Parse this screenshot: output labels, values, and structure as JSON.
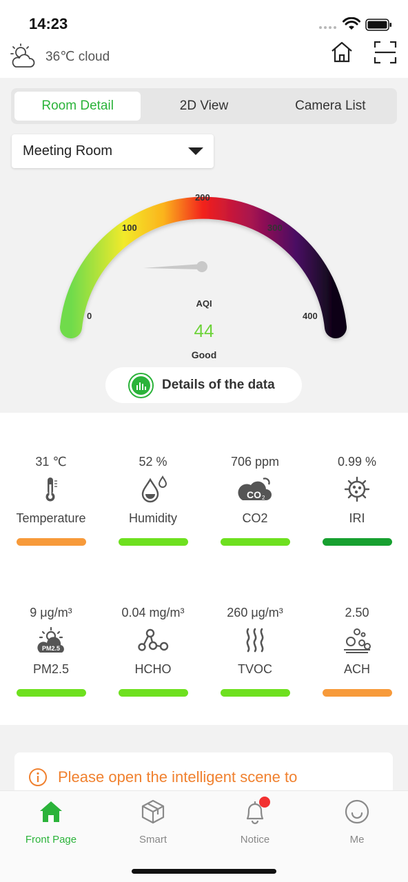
{
  "status_bar": {
    "time": "14:23"
  },
  "weather": {
    "text": "36℃ cloud",
    "icon": "partly-cloudy-icon"
  },
  "top_tabs": [
    {
      "label": "Room Detail",
      "active": true
    },
    {
      "label": "2D View",
      "active": false
    },
    {
      "label": "Camera List",
      "active": false
    }
  ],
  "room_select": {
    "value": "Meeting Room"
  },
  "gauge": {
    "min": 0,
    "max": 400,
    "ticks": [
      "0",
      "100",
      "200",
      "300",
      "400"
    ],
    "label": "AQI",
    "value": "44",
    "status": "Good",
    "value_color": "#6ed33a"
  },
  "details_button": {
    "label": "Details of the data"
  },
  "metrics": [
    {
      "value": "31 ℃",
      "label": "Temperature",
      "icon": "thermometer-icon",
      "bar_color": "#f79a3a"
    },
    {
      "value": "52 %",
      "label": "Humidity",
      "icon": "droplet-icon",
      "bar_color": "#6ee01f"
    },
    {
      "value": "706 ppm",
      "label": "CO2",
      "icon": "co2-cloud-icon",
      "bar_color": "#6ee01f"
    },
    {
      "value": "0.99 %",
      "label": "IRI",
      "icon": "virus-icon",
      "bar_color": "#17a030"
    },
    {
      "value": "9 μg/m³",
      "label": "PM2.5",
      "icon": "pm25-icon",
      "bar_color": "#6ee01f"
    },
    {
      "value": "0.04 mg/m³",
      "label": "HCHO",
      "icon": "molecule-icon",
      "bar_color": "#6ee01f"
    },
    {
      "value": "260 μg/m³",
      "label": "TVOC",
      "icon": "vapor-waves-icon",
      "bar_color": "#6ee01f"
    },
    {
      "value": "2.50",
      "label": "ACH",
      "icon": "air-change-icon",
      "bar_color": "#f79a3a"
    }
  ],
  "notice": {
    "text": "Please open the intelligent scene to",
    "color": "#f0812f"
  },
  "bottom_tabs": [
    {
      "label": "Front Page",
      "icon": "home-filled-icon",
      "active": true
    },
    {
      "label": "Smart",
      "icon": "cube-icon",
      "active": false
    },
    {
      "label": "Notice",
      "icon": "bell-icon",
      "active": false,
      "badge": true
    },
    {
      "label": "Me",
      "icon": "smiley-icon",
      "active": false
    }
  ],
  "colors": {
    "accent": "#2bb33a",
    "warning": "#f0812f"
  }
}
